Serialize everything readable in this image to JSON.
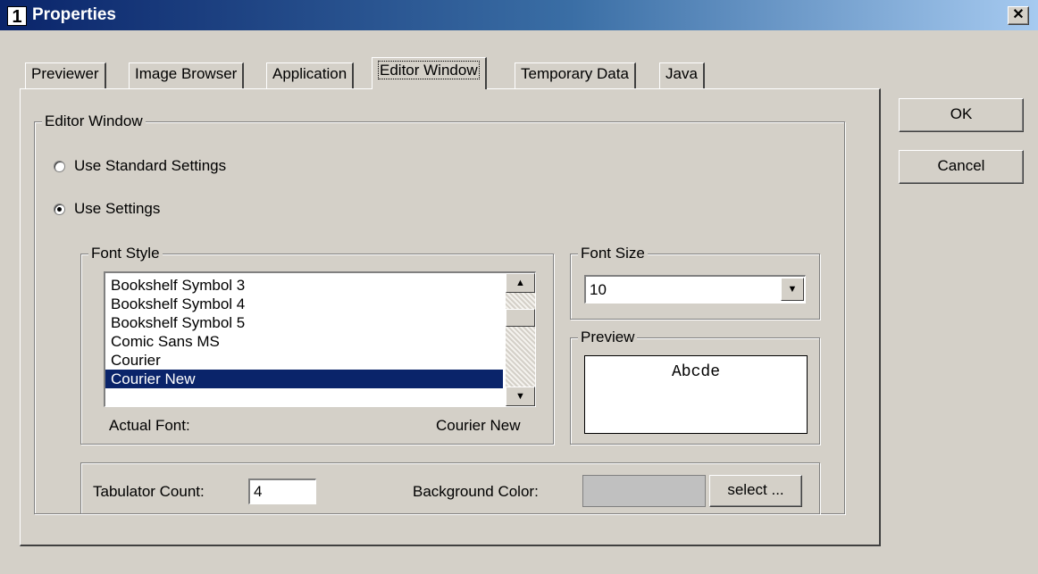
{
  "window": {
    "icon_text": "1",
    "title": "Properties",
    "close_glyph": "✕"
  },
  "tabs": [
    {
      "label": "Previewer",
      "active": false
    },
    {
      "label": "Image Browser",
      "active": false
    },
    {
      "label": "Application",
      "active": false
    },
    {
      "label": "Editor Window",
      "active": true
    },
    {
      "label": "Temporary Data",
      "active": false
    },
    {
      "label": "Java",
      "active": false
    }
  ],
  "editor_group": {
    "legend": "Editor Window",
    "radio_standard": {
      "label": "Use Standard Settings",
      "checked": false
    },
    "radio_custom": {
      "label": "Use Settings",
      "checked": true
    }
  },
  "font_style": {
    "legend": "Font Style",
    "items": [
      "Bookshelf Symbol 3",
      "Bookshelf Symbol 4",
      "Bookshelf Symbol 5",
      "Comic Sans MS",
      "Courier",
      "Courier New"
    ],
    "selected": "Courier New",
    "actual_font_label": "Actual Font:",
    "actual_font_value": "Courier New"
  },
  "font_size": {
    "legend": "Font Size",
    "value": "10"
  },
  "preview": {
    "legend": "Preview",
    "sample_text": "Abcde"
  },
  "misc": {
    "tab_count_label": "Tabulator Count:",
    "tab_count_value": "4",
    "bg_color_label": "Background Color:",
    "bg_color_swatch": "#c0c0c0",
    "select_button": "select ..."
  },
  "dialog_buttons": {
    "ok": "OK",
    "cancel": "Cancel"
  },
  "colors": {
    "selection": "#0a246a",
    "face": "#d4d0c8"
  },
  "icons": {
    "scroll_up": "up-arrow-icon",
    "scroll_down": "down-arrow-icon",
    "combo": "down-arrow-icon"
  }
}
